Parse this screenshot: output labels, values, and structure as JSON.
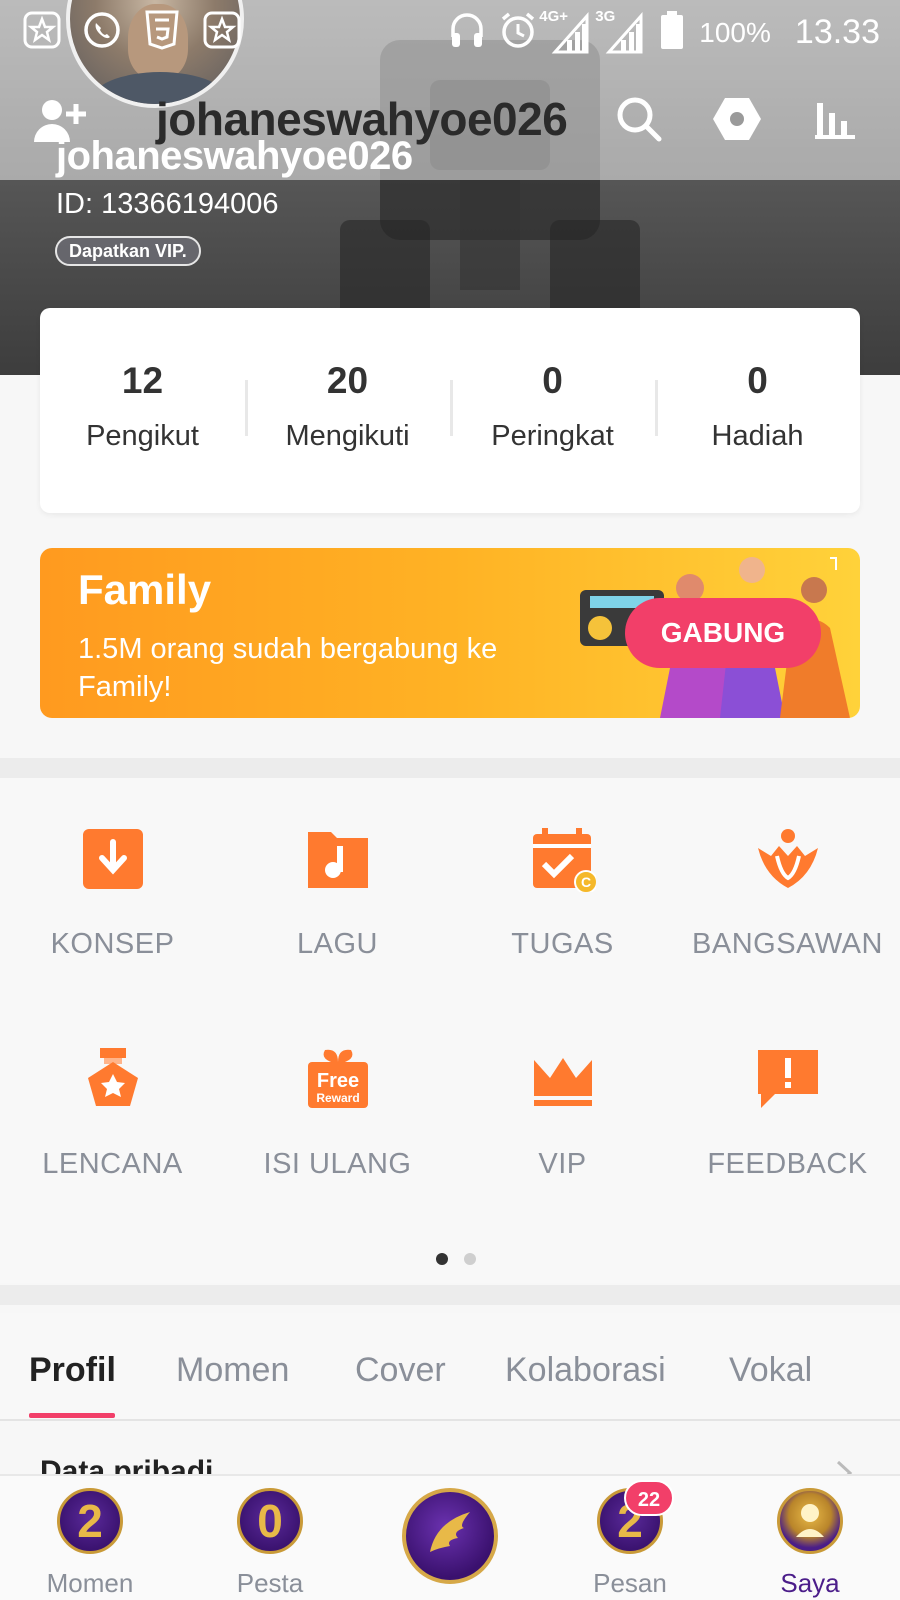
{
  "status_bar": {
    "network_4g": "4G+",
    "network_3g": "3G",
    "battery": "100%",
    "time": "13.33"
  },
  "header": {
    "title": "johaneswahyoe026"
  },
  "profile": {
    "username": "johaneswahyoe026",
    "id": "ID: 13366194006",
    "vip_chip": "Dapatkan VIP."
  },
  "stats": [
    {
      "value": "12",
      "label": "Pengikut"
    },
    {
      "value": "20",
      "label": "Mengikuti"
    },
    {
      "value": "0",
      "label": "Peringkat"
    },
    {
      "value": "0",
      "label": "Hadiah"
    }
  ],
  "family_banner": {
    "title": "Family",
    "subtitle": "1.5M orang sudah bergabung ke Family!",
    "button": "GABUNG"
  },
  "features": [
    {
      "label": "KONSEP",
      "icon": "download-icon"
    },
    {
      "label": "LAGU",
      "icon": "music-folder-icon"
    },
    {
      "label": "TUGAS",
      "icon": "calendar-task-icon"
    },
    {
      "label": "BANGSAWAN",
      "icon": "crown-noble-icon"
    },
    {
      "label": "LENCANA",
      "icon": "badge-icon"
    },
    {
      "label": "ISI ULANG",
      "icon": "free-reward-icon",
      "icon_text": [
        "Free",
        "Reward"
      ]
    },
    {
      "label": "VIP",
      "icon": "crown-icon"
    },
    {
      "label": "FEEDBACK",
      "icon": "feedback-icon"
    }
  ],
  "pager": {
    "pages": 2,
    "active": 1
  },
  "tabs": [
    {
      "label": "Profil",
      "active": true
    },
    {
      "label": "Momen"
    },
    {
      "label": "Cover"
    },
    {
      "label": "Kolaborasi"
    },
    {
      "label": "Vokal"
    }
  ],
  "section": {
    "title": "Data pribadi"
  },
  "bottom_nav": [
    {
      "label": "Momen",
      "badge": "2"
    },
    {
      "label": "Pesta",
      "badge": "0"
    },
    {
      "label": "",
      "badge": ""
    },
    {
      "label": "Pesan",
      "badge": "2",
      "notification": "22"
    },
    {
      "label": "Saya",
      "active": true
    }
  ],
  "colors": {
    "accent": "#f23f69",
    "icon_orange": "#ff7a2f",
    "active_nav": "#4b1d8a",
    "banner_start": "#ff9a1f",
    "banner_end": "#ffd23a"
  }
}
